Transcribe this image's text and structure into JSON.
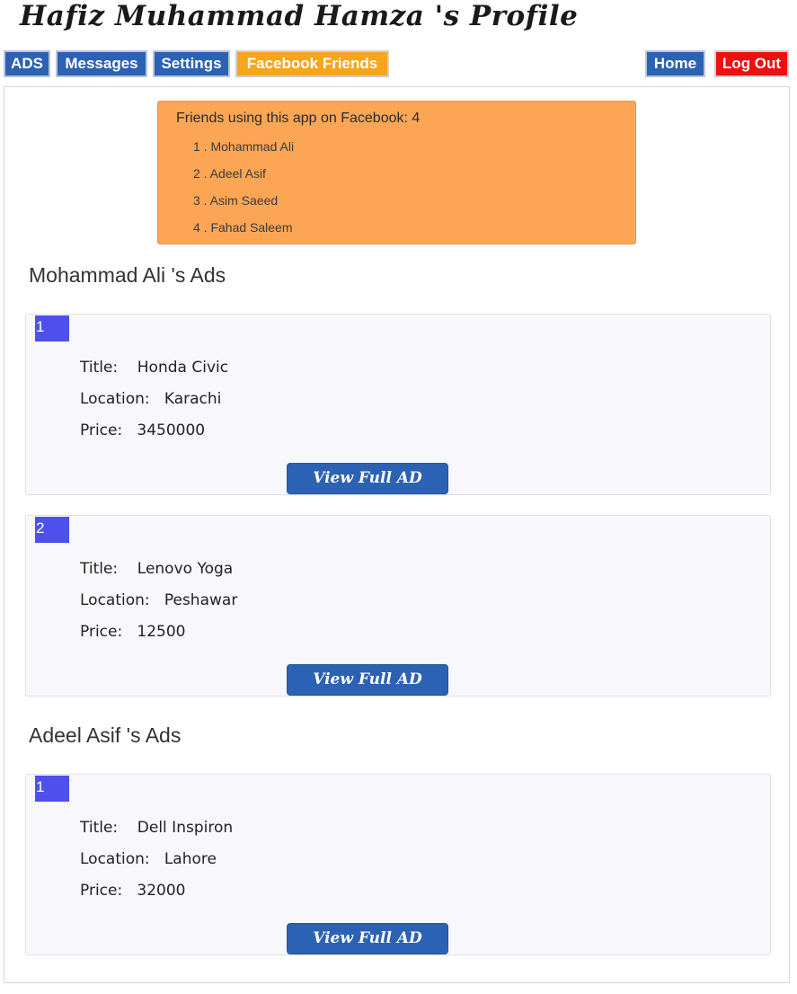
{
  "header": {
    "title": "Hafiz Muhammad Hamza 's Profile"
  },
  "nav": {
    "ads": "ADS",
    "messages": "Messages",
    "settings": "Settings",
    "facebook_friends": "Facebook Friends",
    "home": "Home",
    "logout": "Log Out"
  },
  "friends": {
    "heading": "Friends using this app on Facebook: 4",
    "list": [
      "1 . Mohammad Ali",
      "2 . Adeel Asif",
      "3 . Asim Saeed",
      "4 . Fahad Saleem"
    ]
  },
  "sections": [
    {
      "heading": "Mohammad Ali 's Ads",
      "ads": [
        {
          "num": "1",
          "title": "Title:    Honda Civic",
          "location": "Location:   Karachi",
          "price": "Price:   3450000",
          "button": "View Full AD"
        },
        {
          "num": "2",
          "title": "Title:    Lenovo Yoga",
          "location": "Location:   Peshawar",
          "price": "Price:   12500",
          "button": "View Full AD"
        }
      ]
    },
    {
      "heading": "Adeel Asif 's Ads",
      "ads": [
        {
          "num": "1",
          "title": "Title:    Dell Inspiron",
          "location": "Location:   Lahore",
          "price": "Price:   32000",
          "button": "View Full AD"
        }
      ]
    }
  ],
  "colors": {
    "nav_blue": "#2c62b4",
    "nav_active_orange": "#f7a51c",
    "logout_red": "#ee0f0f",
    "friends_box": "#fca655",
    "ad_number_badge": "#4e50ec",
    "ad_card_bg": "#f8f8fc"
  }
}
